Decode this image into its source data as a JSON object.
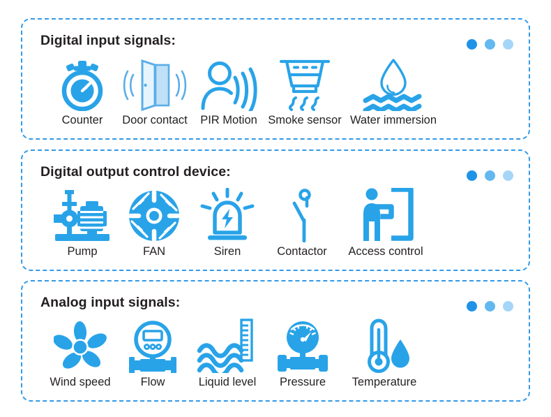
{
  "colors": {
    "accent": "#29a3e8",
    "accent_dark": "#1f93e8",
    "accent_mid": "#63b8f0",
    "accent_light": "#a5d6f7",
    "border_dash": "#3399e6",
    "text": "#231f20",
    "door_fill": "#ddeffc",
    "door_panel": "#bfe0f7",
    "background": "#ffffff"
  },
  "panels": [
    {
      "id": "digital-input-signals",
      "title": "Digital input signals:",
      "more_indicator": "three-dots",
      "items": [
        {
          "label": "Counter",
          "icon": "stopwatch-icon"
        },
        {
          "label": "Door contact",
          "icon": "door-contact-icon"
        },
        {
          "label": "PIR Motion",
          "icon": "pir-motion-icon"
        },
        {
          "label": "Smoke sensor",
          "icon": "smoke-sensor-icon"
        },
        {
          "label": "Water immersion",
          "icon": "water-immersion-icon"
        }
      ]
    },
    {
      "id": "digital-output-control-device",
      "title": "Digital output control device:",
      "more_indicator": "three-dots",
      "items": [
        {
          "label": "Pump",
          "icon": "pump-icon"
        },
        {
          "label": "FAN",
          "icon": "fan-icon"
        },
        {
          "label": "Siren",
          "icon": "siren-icon"
        },
        {
          "label": "Contactor",
          "icon": "contactor-icon"
        },
        {
          "label": "Access control",
          "icon": "access-control-icon"
        }
      ]
    },
    {
      "id": "analog-input-signals",
      "title": "Analog input signals:",
      "more_indicator": "three-dots",
      "items": [
        {
          "label": "Wind speed",
          "icon": "anemometer-icon"
        },
        {
          "label": "Flow",
          "icon": "flow-meter-icon"
        },
        {
          "label": "Liquid level",
          "icon": "liquid-level-icon"
        },
        {
          "label": "Pressure",
          "icon": "pressure-gauge-icon"
        },
        {
          "label": "Temperature",
          "icon": "thermometer-icon"
        }
      ]
    }
  ]
}
